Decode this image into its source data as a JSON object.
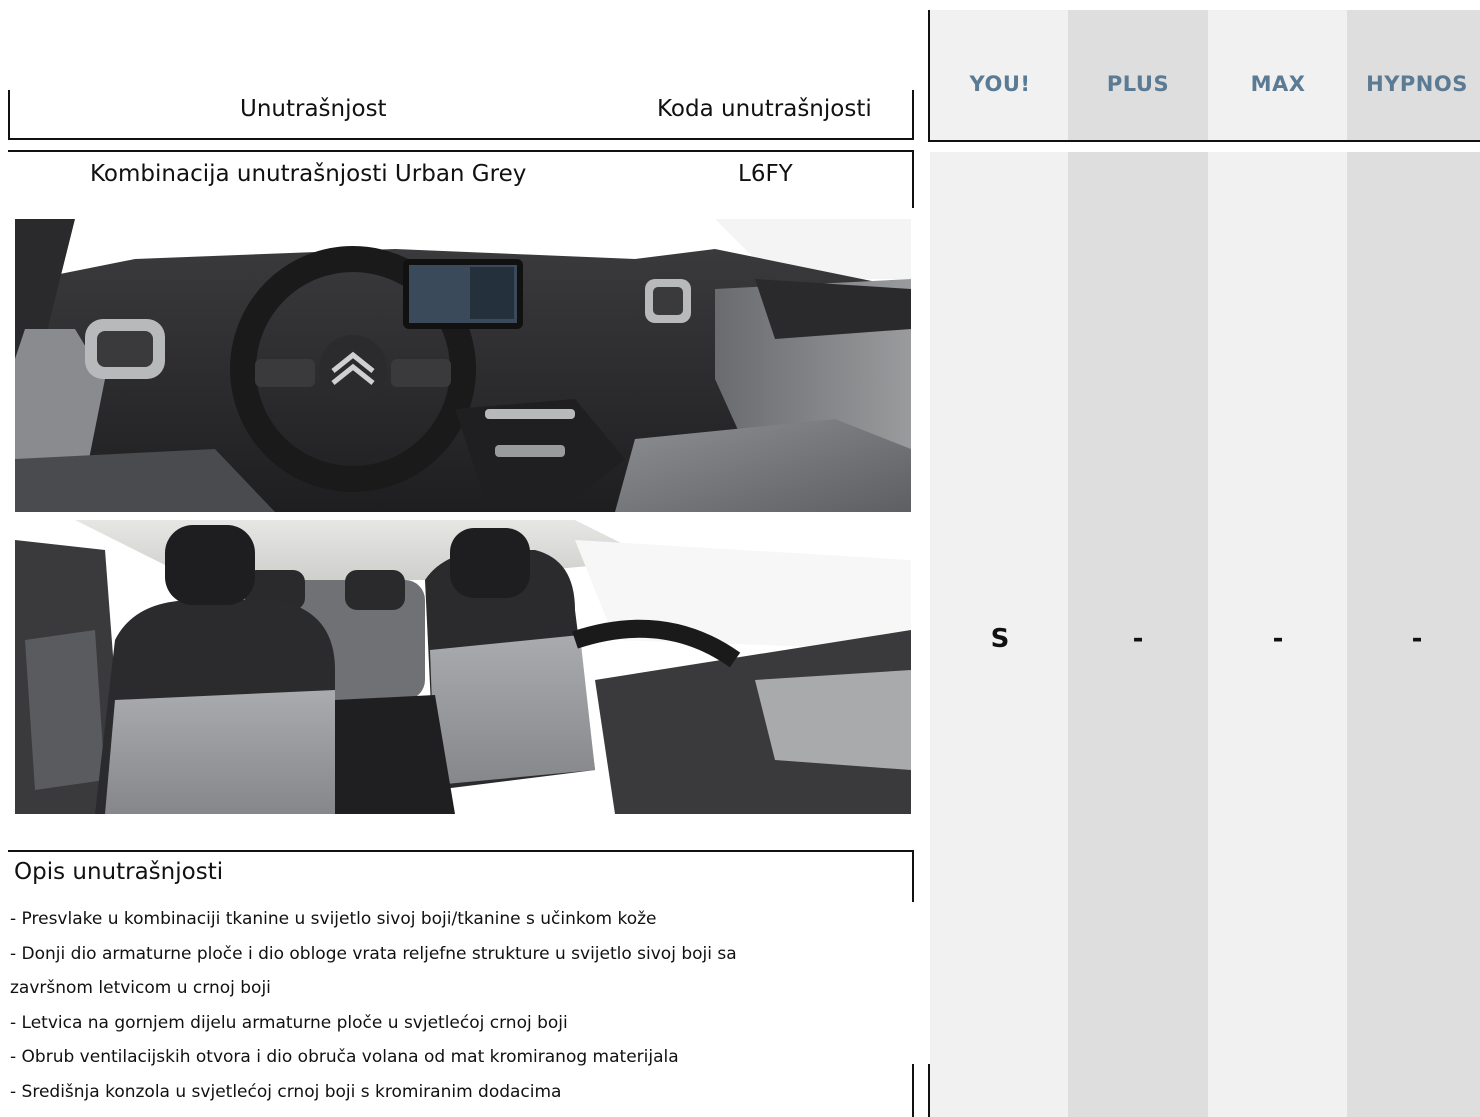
{
  "header": {
    "interior_label": "Unutrašnjost",
    "code_label": "Koda unutrašnjosti"
  },
  "trims": [
    {
      "name": "YOU!",
      "value": "S"
    },
    {
      "name": "PLUS",
      "value": "-"
    },
    {
      "name": "MAX",
      "value": "-"
    },
    {
      "name": "HYPNOS",
      "value": "-"
    }
  ],
  "interior": {
    "name": "Kombinacija unutrašnjosti Urban Grey",
    "code": "L6FY"
  },
  "description": {
    "title": "Opis unutrašnjosti",
    "lines": [
      "- Presvlake u kombinaciji tkanine u svijetlo sivoj boji/tkanine s učinkom kože",
      "- Donji dio armaturne ploče i dio obloge vrata reljefne strukture u svijetlo sivoj boji sa",
      "završnom letvicom u crnoj boji",
      "- Letvica na gornjem dijelu armaturne ploče u svjetlećoj crnoj boji",
      "- Obrub ventilacijskih otvora i dio obruča volana od mat kromiranog materijala",
      "- Središnja konzola u svjetlećoj crnoj boji s kromiranim dodacima"
    ]
  },
  "colors": {
    "trim_header_text": "#5b7a93",
    "column_shade": "#dedede",
    "column_light": "#f1f1f1"
  }
}
